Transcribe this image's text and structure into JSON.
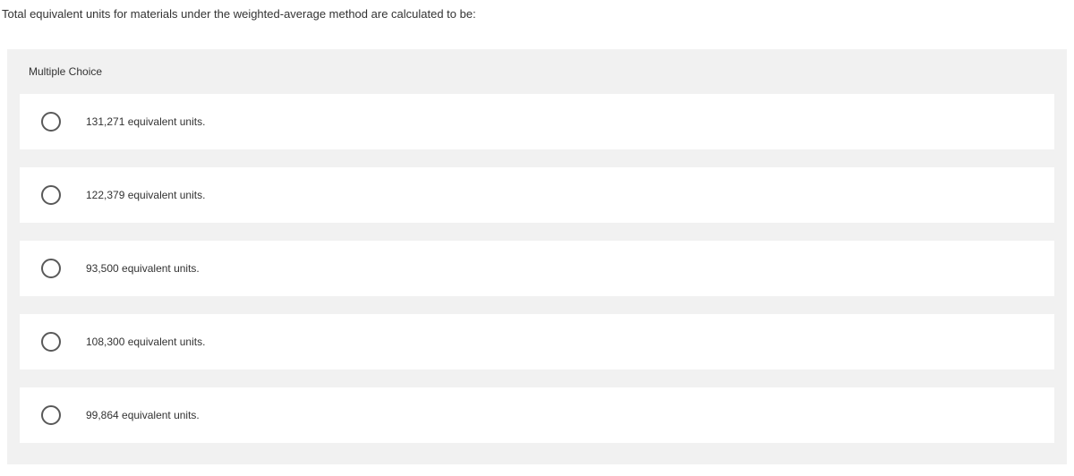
{
  "question": {
    "text": "Total equivalent units for materials under the weighted-average method are calculated to be:"
  },
  "section": {
    "header": "Multiple Choice"
  },
  "options": [
    {
      "label": "131,271 equivalent units."
    },
    {
      "label": "122,379 equivalent units."
    },
    {
      "label": "93,500 equivalent units."
    },
    {
      "label": "108,300 equivalent units."
    },
    {
      "label": "99,864 equivalent units."
    }
  ]
}
